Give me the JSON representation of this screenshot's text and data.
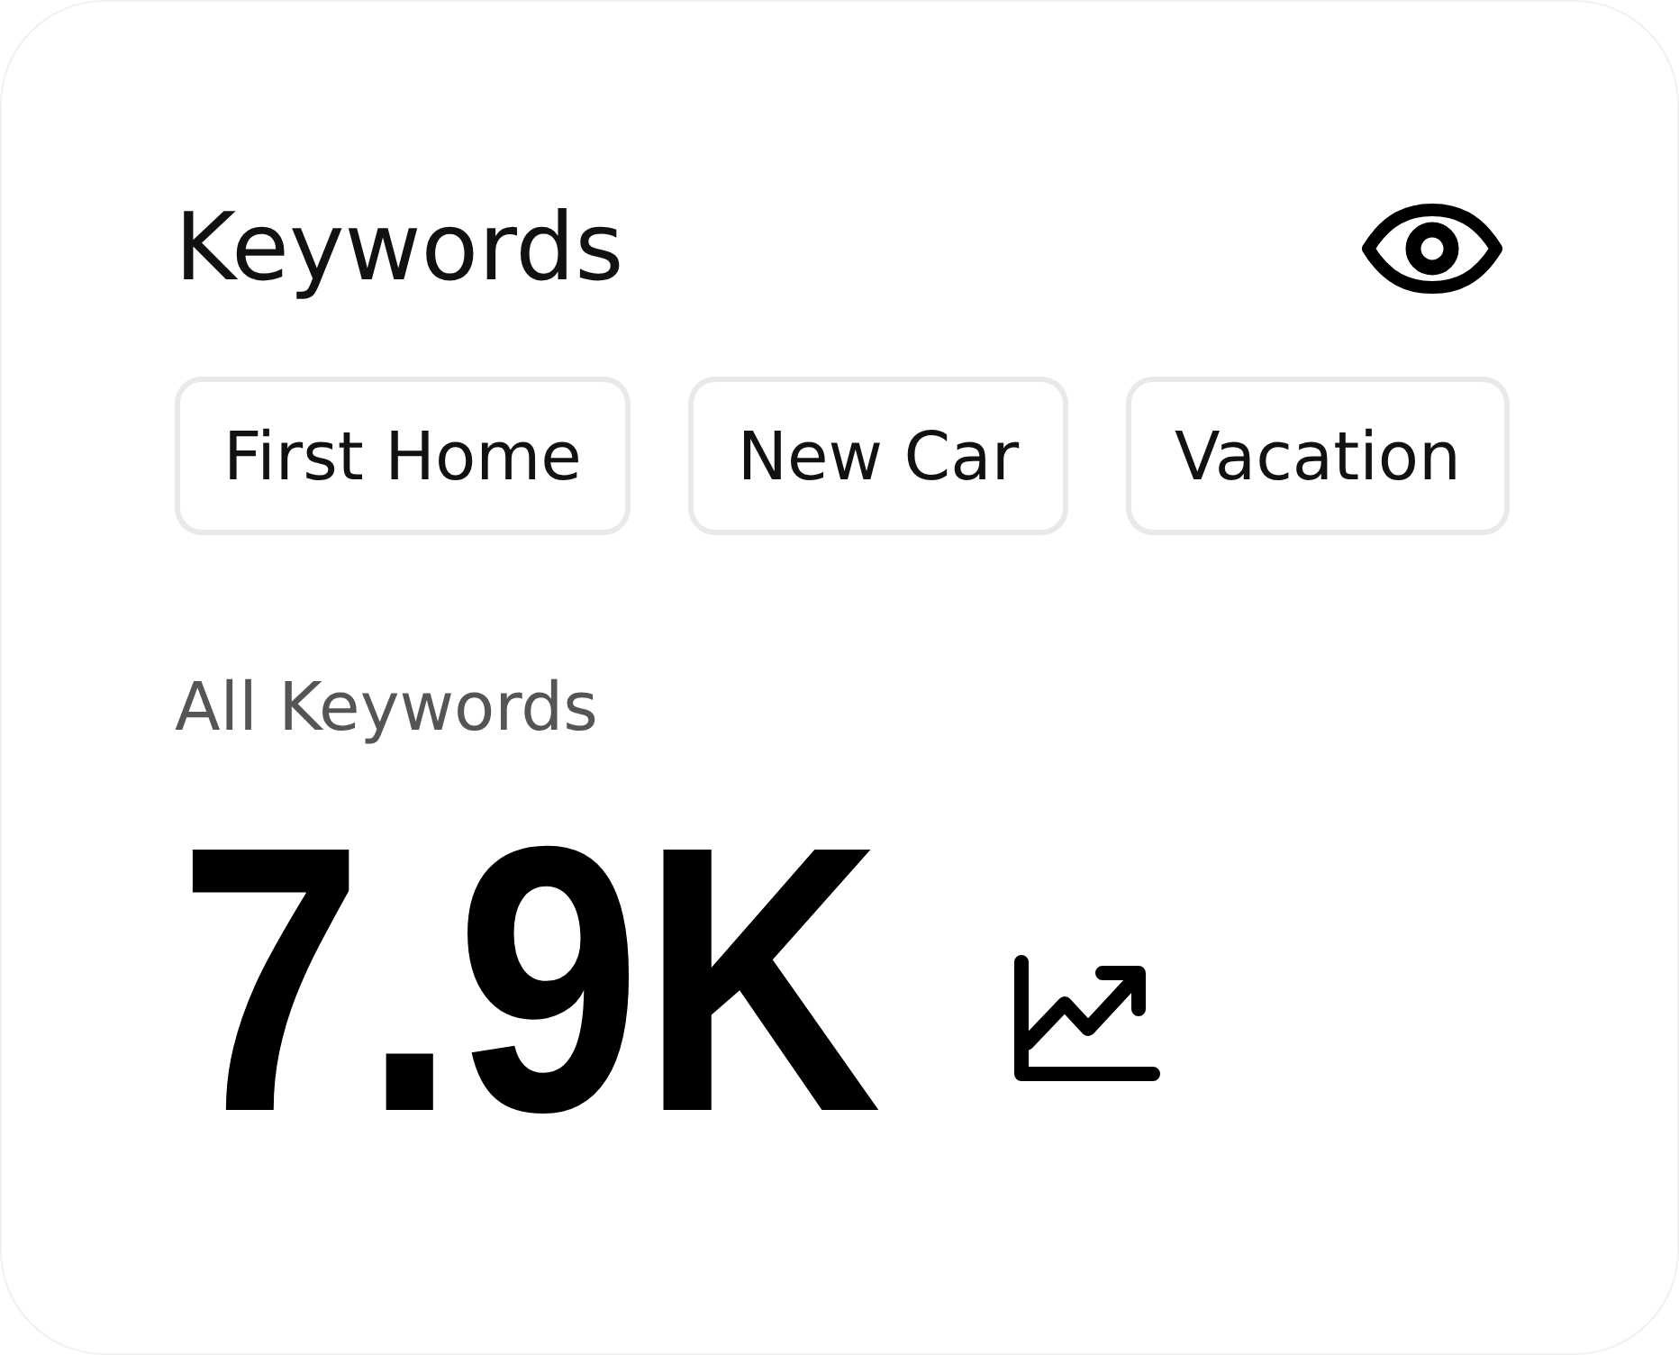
{
  "card": {
    "title": "Keywords"
  },
  "keywords": [
    {
      "label": "First Home"
    },
    {
      "label": "New Car"
    },
    {
      "label": "Vacation"
    }
  ],
  "summary": {
    "label": "All Keywords",
    "value": "7.9K"
  }
}
